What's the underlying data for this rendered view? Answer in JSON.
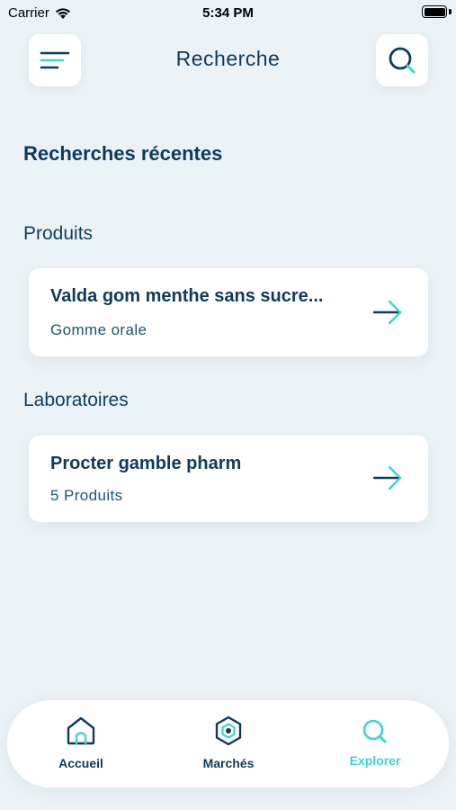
{
  "status_bar": {
    "carrier": "Carrier",
    "time": "5:34 PM"
  },
  "header": {
    "title": "Recherche",
    "menu_icon": "menu-icon",
    "search_icon": "search-icon"
  },
  "section_title": "Recherches récentes",
  "groups": [
    {
      "label": "Produits",
      "items": [
        {
          "title": "Valda gom menthe sans sucre...",
          "subtitle": "Gomme orale"
        }
      ]
    },
    {
      "label": "Laboratoires",
      "items": [
        {
          "title": "Procter gamble pharm",
          "subtitle": "5 Produits"
        }
      ]
    }
  ],
  "tabbar": {
    "tabs": [
      {
        "label": "Accueil",
        "icon": "home-icon",
        "active": false
      },
      {
        "label": "Marchés",
        "icon": "hexagon-icon",
        "active": false
      },
      {
        "label": "Explorer",
        "icon": "search-icon",
        "active": true
      }
    ]
  },
  "colors": {
    "accent": "#3ad6cf",
    "primary": "#0e3a5c",
    "background": "#eaf2f6",
    "card": "#ffffff"
  }
}
